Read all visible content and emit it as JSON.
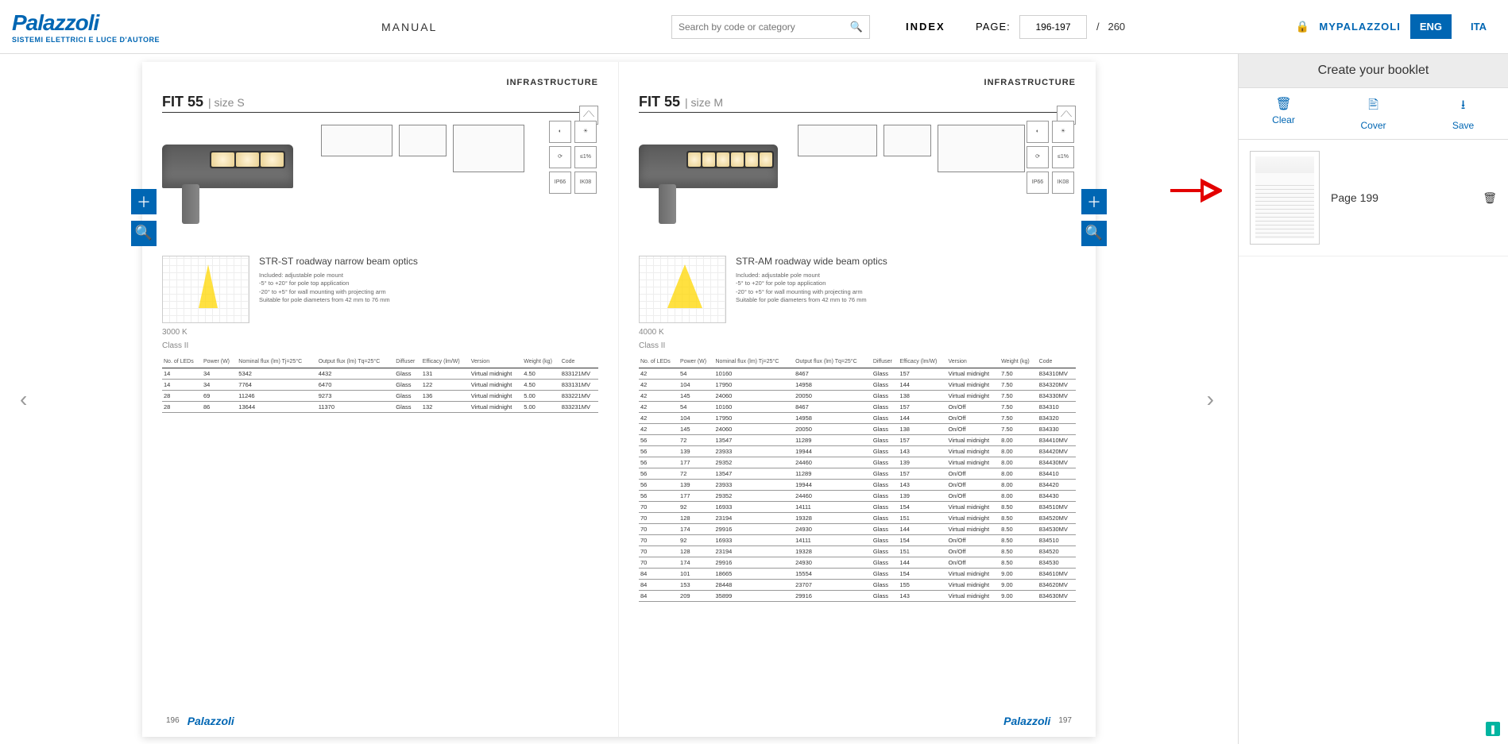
{
  "header": {
    "brand": "Palazzoli",
    "brand_sub": "SISTEMI ELETTRICI E LUCE D'AUTORE",
    "manual": "MANUAL",
    "search_placeholder": "Search by code or category",
    "index": "INDEX",
    "page_label": "PAGE:",
    "page_value": "196-197",
    "page_sep": "/",
    "page_total": "260",
    "mypalazzoli": "MYPALAZZOLI",
    "lang_eng": "ENG",
    "lang_ita": "ITA"
  },
  "sidebar": {
    "title": "Create your booklet",
    "clear": "Clear",
    "cover": "Cover",
    "save": "Save",
    "item_label": "Page 199"
  },
  "left_page": {
    "category": "INFRASTRUCTURE",
    "title": "FIT 55",
    "size": "| size S",
    "optics_title": "STR-ST roadway narrow beam optics",
    "optics_desc": [
      "Included: adjustable pole mount",
      "-5° to +20° for pole top application",
      "-20° to +5° for wall mounting with projecting arm",
      "Suitable for pole diameters from 42 mm to 76 mm"
    ],
    "temp": "3000 K",
    "class": "Class II",
    "ip": "IP66",
    "ik": "IK08",
    "page_num": "196",
    "footer_logo": "Palazzoli",
    "table_headers": [
      "No. of LEDs",
      "Power (W)",
      "Nominal flux (lm) Tj=25°C",
      "Output flux (lm) Tq=25°C",
      "Diffuser",
      "Efficacy (lm/W)",
      "Version",
      "Weight (kg)",
      "Code"
    ],
    "rows": [
      [
        "14",
        "34",
        "5342",
        "4432",
        "Glass",
        "131",
        "Virtual midnight",
        "4.50",
        "833121MV"
      ],
      [
        "14",
        "34",
        "7764",
        "6470",
        "Glass",
        "122",
        "Virtual midnight",
        "4.50",
        "833131MV"
      ],
      [
        "28",
        "69",
        "11246",
        "9273",
        "Glass",
        "136",
        "Virtual midnight",
        "5.00",
        "833221MV"
      ],
      [
        "28",
        "86",
        "13644",
        "11370",
        "Glass",
        "132",
        "Virtual midnight",
        "5.00",
        "833231MV"
      ]
    ]
  },
  "right_page": {
    "category": "INFRASTRUCTURE",
    "title": "FIT 55",
    "size": "| size M",
    "optics_title": "STR-AM roadway wide beam optics",
    "optics_desc": [
      "Included: adjustable pole mount",
      "-5° to +20° for pole top application",
      "-20° to +5° for wall mounting with projecting arm",
      "Suitable for pole diameters from 42 mm to 76 mm"
    ],
    "temp": "4000 K",
    "class": "Class II",
    "ip": "IP66",
    "ik": "IK08",
    "page_num": "197",
    "footer_logo": "Palazzoli",
    "table_headers": [
      "No. of LEDs",
      "Power (W)",
      "Nominal flux (lm) Tj=25°C",
      "Output flux (lm) Tq=25°C",
      "Diffuser",
      "Efficacy (lm/W)",
      "Version",
      "Weight (kg)",
      "Code"
    ],
    "rows": [
      [
        "42",
        "54",
        "10160",
        "8467",
        "Glass",
        "157",
        "Virtual midnight",
        "7.50",
        "834310MV"
      ],
      [
        "42",
        "104",
        "17950",
        "14958",
        "Glass",
        "144",
        "Virtual midnight",
        "7.50",
        "834320MV"
      ],
      [
        "42",
        "145",
        "24060",
        "20050",
        "Glass",
        "138",
        "Virtual midnight",
        "7.50",
        "834330MV"
      ],
      [
        "42",
        "54",
        "10160",
        "8467",
        "Glass",
        "157",
        "On/Off",
        "7.50",
        "834310"
      ],
      [
        "42",
        "104",
        "17950",
        "14958",
        "Glass",
        "144",
        "On/Off",
        "7.50",
        "834320"
      ],
      [
        "42",
        "145",
        "24060",
        "20050",
        "Glass",
        "138",
        "On/Off",
        "7.50",
        "834330"
      ],
      [
        "56",
        "72",
        "13547",
        "11289",
        "Glass",
        "157",
        "Virtual midnight",
        "8.00",
        "834410MV"
      ],
      [
        "56",
        "139",
        "23933",
        "19944",
        "Glass",
        "143",
        "Virtual midnight",
        "8.00",
        "834420MV"
      ],
      [
        "56",
        "177",
        "29352",
        "24460",
        "Glass",
        "139",
        "Virtual midnight",
        "8.00",
        "834430MV"
      ],
      [
        "56",
        "72",
        "13547",
        "11289",
        "Glass",
        "157",
        "On/Off",
        "8.00",
        "834410"
      ],
      [
        "56",
        "139",
        "23933",
        "19944",
        "Glass",
        "143",
        "On/Off",
        "8.00",
        "834420"
      ],
      [
        "56",
        "177",
        "29352",
        "24460",
        "Glass",
        "139",
        "On/Off",
        "8.00",
        "834430"
      ],
      [
        "70",
        "92",
        "16933",
        "14111",
        "Glass",
        "154",
        "Virtual midnight",
        "8.50",
        "834510MV"
      ],
      [
        "70",
        "128",
        "23194",
        "19328",
        "Glass",
        "151",
        "Virtual midnight",
        "8.50",
        "834520MV"
      ],
      [
        "70",
        "174",
        "29916",
        "24930",
        "Glass",
        "144",
        "Virtual midnight",
        "8.50",
        "834530MV"
      ],
      [
        "70",
        "92",
        "16933",
        "14111",
        "Glass",
        "154",
        "On/Off",
        "8.50",
        "834510"
      ],
      [
        "70",
        "128",
        "23194",
        "19328",
        "Glass",
        "151",
        "On/Off",
        "8.50",
        "834520"
      ],
      [
        "70",
        "174",
        "29916",
        "24930",
        "Glass",
        "144",
        "On/Off",
        "8.50",
        "834530"
      ],
      [
        "84",
        "101",
        "18665",
        "15554",
        "Glass",
        "154",
        "Virtual midnight",
        "9.00",
        "834610MV"
      ],
      [
        "84",
        "153",
        "28448",
        "23707",
        "Glass",
        "155",
        "Virtual midnight",
        "9.00",
        "834620MV"
      ],
      [
        "84",
        "209",
        "35899",
        "29916",
        "Glass",
        "143",
        "Virtual midnight",
        "9.00",
        "834630MV"
      ]
    ]
  }
}
